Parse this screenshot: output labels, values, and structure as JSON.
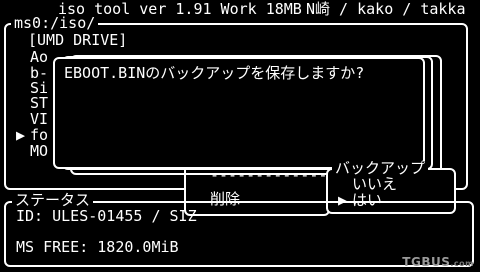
{
  "header": {
    "app_info": "iso_tool ver 1.91 Work 18MB",
    "credits": "N崎 / kako / takka"
  },
  "browser": {
    "path": "ms0:/iso/",
    "items": [
      "[UMD DRIVE]",
      "Ao",
      "b-",
      "Si",
      "ST",
      "VI",
      "fo",
      "MO"
    ],
    "cursor": "▶"
  },
  "dialog": {
    "message": "EBOOT.BINのバックアップを保存しますか?"
  },
  "context_menu": {
    "separator": "-------------",
    "delete_label": "削除"
  },
  "backup_menu": {
    "title": "バックアップ",
    "options": [
      "いいえ",
      "はい"
    ],
    "selected_index": 1,
    "cursor": "▶"
  },
  "status": {
    "title": "ステータス",
    "id_line": "ID: ULES-01455 / SIZ",
    "free_line": "MS FREE: 1820.0MiB"
  },
  "watermark": {
    "brand": "TGBUS",
    "suffix": ".com"
  }
}
